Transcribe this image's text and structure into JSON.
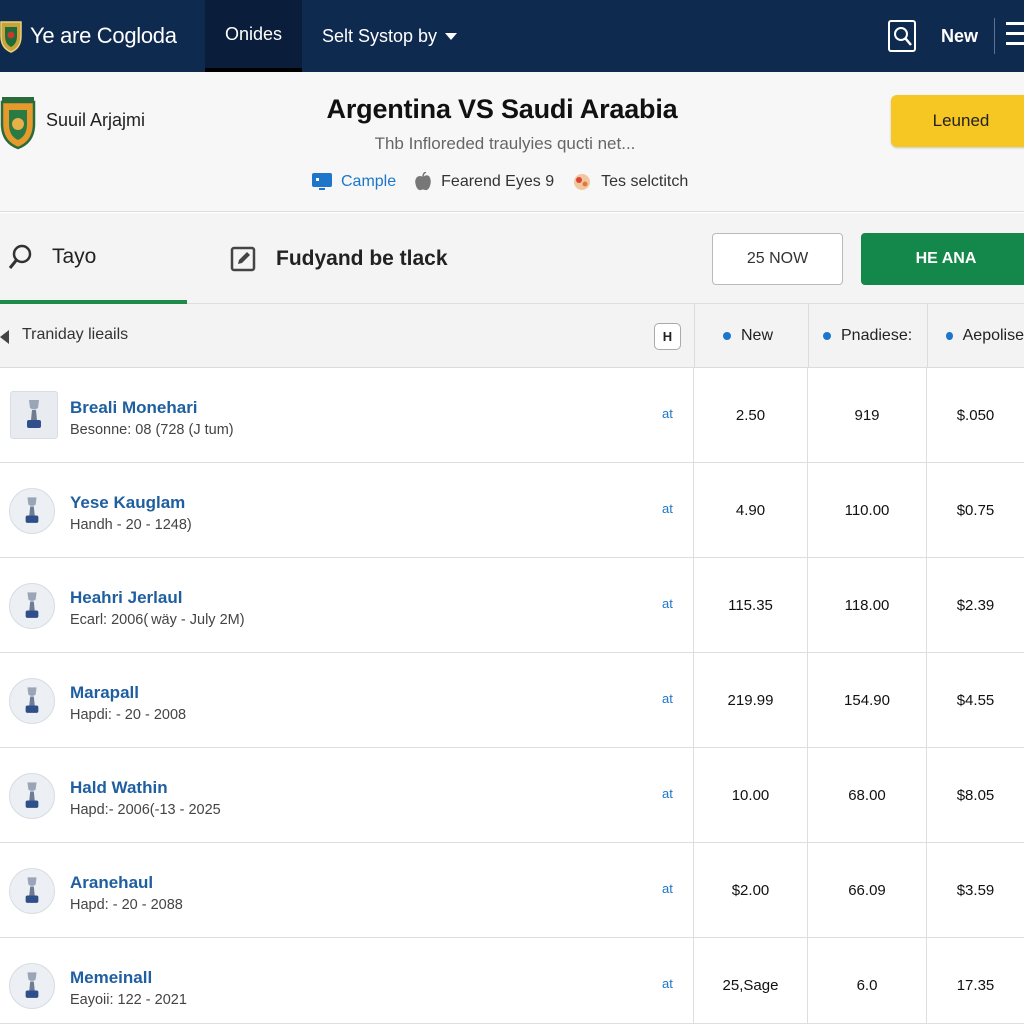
{
  "nav": {
    "brand": "Ye are Cogloda",
    "active_tab": "Onides",
    "select_label": "Selt Systop by",
    "new_label": "New"
  },
  "match": {
    "team_name": "Suuil Arjajmi",
    "title": "Argentina VS Saudi Araabia",
    "subtitle": "Thb Infloreded traulyies qucti net...",
    "meta": [
      "Cample",
      "Fearend Eyes 9",
      "Tes selctitch"
    ],
    "cta_label": "Leuned"
  },
  "tabs": {
    "tab1_label": "Tayo",
    "tab2_label": "Fudyand be tlack",
    "outline_button": "25 NOW",
    "green_button": "HE ANA"
  },
  "table": {
    "title": "Traniday lieails",
    "h_badge": "H",
    "columns": [
      "New",
      "Pnadiese:",
      "Aepolise"
    ],
    "rows": [
      {
        "name": "Breali Monehari",
        "meta": "Besonne: 08 (728 (J tum)",
        "at": "at",
        "v1": "2.50",
        "v2": "919",
        "v3": "$.050"
      },
      {
        "name": "Yese Kauglam",
        "meta": "Handh - 20 - 1248)",
        "at": "at",
        "v1": "4.90",
        "v2": "110.00",
        "v3": "$0.75"
      },
      {
        "name": "Heahri Jerlaul",
        "meta": "Ecarl: 2006( wäy - July 2M)",
        "at": "at",
        "v1": "115.35",
        "v2": "118.00",
        "v3": "$2.39"
      },
      {
        "name": "Marapall",
        "meta": "Hapdi: - 20 - 2008",
        "at": "at",
        "v1": "219.99",
        "v2": "154.90",
        "v3": "$4.55"
      },
      {
        "name": "Hald Wathin",
        "meta": "Hapd:- 2006(-13 - 2025",
        "at": "at",
        "v1": "10.00",
        "v2": "68.00",
        "v3": "$8.05"
      },
      {
        "name": "Aranehaul",
        "meta": "Hapd: - 20 - 2088",
        "at": "at",
        "v1": "$2.00",
        "v2": "66.09",
        "v3": "$3.59"
      },
      {
        "name": "Memeinall",
        "meta": "Eayoii: 122 - 2021",
        "at": "at",
        "v1": "25,Sage",
        "v2": "6.0",
        "v3": "17.35"
      }
    ]
  },
  "colors": {
    "nav_bg": "#0f2a4f",
    "accent_green": "#14874a",
    "accent_yellow": "#f6c623",
    "link_blue": "#1f5fa0"
  }
}
